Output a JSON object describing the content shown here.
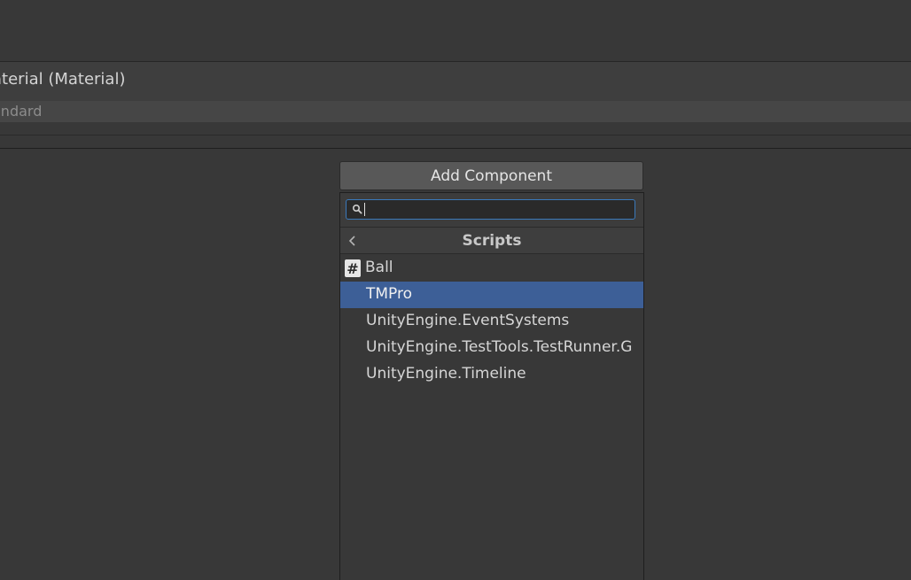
{
  "material": {
    "title": "aterial (Material)",
    "shader_value": "andard"
  },
  "add_component": {
    "label": "Add Component"
  },
  "popup": {
    "search": {
      "value": "",
      "placeholder": ""
    },
    "breadcrumb": {
      "title": "Scripts",
      "back_icon": "chevron-left-icon"
    },
    "items": [
      {
        "label": "Ball",
        "icon": "csharp-script-icon",
        "selected": false
      },
      {
        "label": "TMPro",
        "selected": true
      },
      {
        "label": "UnityEngine.EventSystems",
        "selected": false
      },
      {
        "label": "UnityEngine.TestTools.TestRunner.G",
        "selected": false
      },
      {
        "label": "UnityEngine.Timeline",
        "selected": false
      }
    ]
  },
  "colors": {
    "background": "#383838",
    "selection": "#3d5f97",
    "search_focus": "#3a79bb"
  }
}
